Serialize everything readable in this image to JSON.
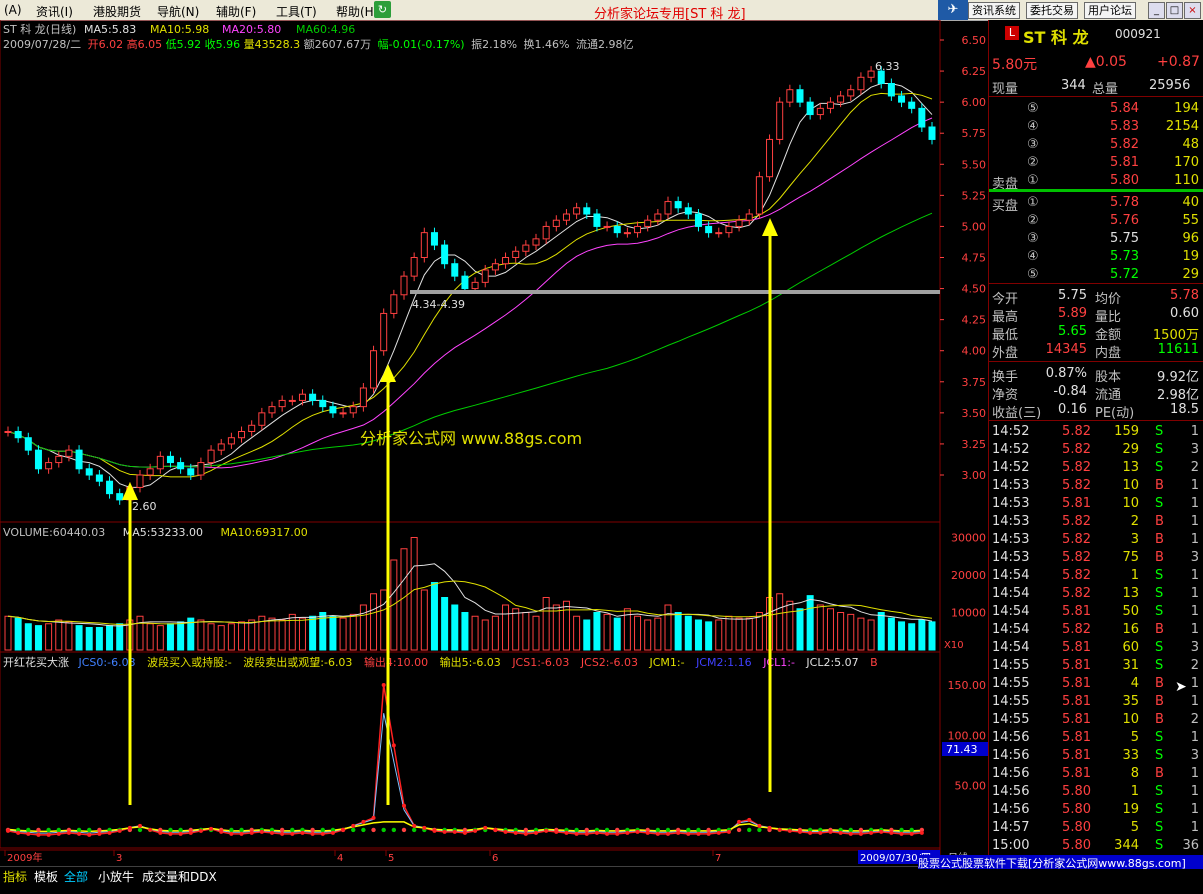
{
  "menu": {
    "items": [
      "(A)",
      "资讯(I)",
      "港股期货",
      "导航(N)",
      "辅助(F)",
      "工具(T)",
      "帮助(H)"
    ],
    "title": "分析家论坛专用[ST 科 龙]",
    "buttons": [
      "资讯系统",
      "委托交易",
      "用户论坛"
    ],
    "window_controls": [
      "_",
      "□",
      "×"
    ]
  },
  "chart": {
    "header1": {
      "name": "ST 科 龙(日线)",
      "ma5": "MA5:5.83",
      "ma10": "MA10:5.98",
      "ma20": "MA20:5.80",
      "ma60": "MA60:4.96"
    },
    "header2": {
      "date": "2009/07/28/二",
      "open": "开6.02",
      "high": "高6.05",
      "low": "低5.92",
      "close": "收5.96",
      "vol": "量43528.3",
      "amt": "额2607.67万",
      "chg": "幅-0.01(-0.17%)",
      "amp": "振2.18%",
      "turn": "换1.46%",
      "float": "流通2.98亿"
    },
    "price_axis": [
      "6.50",
      "6.25",
      "6.00",
      "5.75",
      "5.50",
      "5.25",
      "5.00",
      "4.75",
      "4.50",
      "4.25",
      "4.00",
      "3.75",
      "3.50",
      "3.25",
      "3.00"
    ],
    "annotations": {
      "low_label": "2.60",
      "high_label": "6.33",
      "range_label": "4.34-4.39",
      "watermark": "分析家公式网  www.88gs.com"
    },
    "volume_header": {
      "volume": "VOLUME:60440.03",
      "ma5": "MA5:53233.00",
      "ma10": "MA10:69317.00"
    },
    "volume_axis": [
      "30000",
      "20000",
      "10000"
    ],
    "volume_unit": "X10",
    "indicator_header": {
      "name": "开红花买大涨",
      "jcs0": "JCS0:-6.03",
      "buy": "波段买入或持股:-",
      "sell": "波段卖出或观望:-6.03",
      "out1": "输出4:10.00",
      "out5": "输出5:-6.03",
      "jcs1": "JCS1:-6.03",
      "jcs2": "JCS2:-6.03",
      "jcm1": "JCM1:-",
      "jcm2": "JCM2:1.16",
      "jcl1": "JCL1:-",
      "jcl2": "JCL2:5.07",
      "b": "B"
    },
    "indicator_axis": [
      "150.00",
      "100.00",
      "50.00"
    ],
    "indicator_current": "71.43",
    "date_axis": [
      "2009年",
      "3",
      "4",
      "5",
      "6",
      "7"
    ],
    "date_end": "2009/07/30/四",
    "period": "日线"
  },
  "side": {
    "badge": "L",
    "stock_name": "ST 科 龙",
    "code": "000921",
    "price": "5.80元",
    "change": "▲0.05",
    "change2": "+0.87",
    "now_vol_label": "现量",
    "now_vol": "344",
    "total_vol_label": "总量",
    "total_vol": "25956",
    "sell_label": "卖盘",
    "buy_label": "买盘",
    "sells": [
      {
        "lvl": "⑤",
        "price": "5.84",
        "vol": "194"
      },
      {
        "lvl": "④",
        "price": "5.83",
        "vol": "2154"
      },
      {
        "lvl": "③",
        "price": "5.82",
        "vol": "48"
      },
      {
        "lvl": "②",
        "price": "5.81",
        "vol": "170"
      },
      {
        "lvl": "①",
        "price": "5.80",
        "vol": "110"
      }
    ],
    "buys": [
      {
        "lvl": "①",
        "price": "5.78",
        "vol": "40"
      },
      {
        "lvl": "②",
        "price": "5.76",
        "vol": "55"
      },
      {
        "lvl": "③",
        "price": "5.75",
        "vol": "96"
      },
      {
        "lvl": "④",
        "price": "5.73",
        "vol": "19"
      },
      {
        "lvl": "⑤",
        "price": "5.72",
        "vol": "29"
      }
    ],
    "stats1": [
      {
        "l1": "今开",
        "v1": "5.75",
        "l2": "均价",
        "v2": "5.78"
      },
      {
        "l1": "最高",
        "v1": "5.89",
        "l2": "量比",
        "v2": "0.60"
      },
      {
        "l1": "最低",
        "v1": "5.65",
        "l2": "金额",
        "v2": "1500万"
      },
      {
        "l1": "外盘",
        "v1": "14345",
        "l2": "内盘",
        "v2": "11611"
      }
    ],
    "stats2": [
      {
        "l1": "换手",
        "v1": "0.87%",
        "l2": "股本",
        "v2": "9.92亿"
      },
      {
        "l1": "净资",
        "v1": "-0.84",
        "l2": "流通",
        "v2": "2.98亿"
      },
      {
        "l1": "收益(三)",
        "v1": "0.16",
        "l2": "PE(动)",
        "v2": "18.5"
      }
    ],
    "ticks": [
      {
        "t": "14:52",
        "p": "5.82",
        "v": "159",
        "d": "S",
        "n": "1"
      },
      {
        "t": "14:52",
        "p": "5.82",
        "v": "29",
        "d": "S",
        "n": "3"
      },
      {
        "t": "14:52",
        "p": "5.82",
        "v": "13",
        "d": "S",
        "n": "2"
      },
      {
        "t": "14:53",
        "p": "5.82",
        "v": "10",
        "d": "B",
        "n": "1"
      },
      {
        "t": "14:53",
        "p": "5.81",
        "v": "10",
        "d": "S",
        "n": "1"
      },
      {
        "t": "14:53",
        "p": "5.82",
        "v": "2",
        "d": "B",
        "n": "1"
      },
      {
        "t": "14:53",
        "p": "5.82",
        "v": "3",
        "d": "B",
        "n": "1"
      },
      {
        "t": "14:53",
        "p": "5.82",
        "v": "75",
        "d": "B",
        "n": "3"
      },
      {
        "t": "14:54",
        "p": "5.82",
        "v": "1",
        "d": "S",
        "n": "1"
      },
      {
        "t": "14:54",
        "p": "5.82",
        "v": "13",
        "d": "S",
        "n": "1"
      },
      {
        "t": "14:54",
        "p": "5.81",
        "v": "50",
        "d": "S",
        "n": "1"
      },
      {
        "t": "14:54",
        "p": "5.82",
        "v": "16",
        "d": "B",
        "n": "1"
      },
      {
        "t": "14:54",
        "p": "5.81",
        "v": "60",
        "d": "S",
        "n": "3"
      },
      {
        "t": "14:55",
        "p": "5.81",
        "v": "31",
        "d": "S",
        "n": "2"
      },
      {
        "t": "14:55",
        "p": "5.81",
        "v": "4",
        "d": "B",
        "n": "1"
      },
      {
        "t": "14:55",
        "p": "5.81",
        "v": "35",
        "d": "B",
        "n": "1"
      },
      {
        "t": "14:55",
        "p": "5.81",
        "v": "10",
        "d": "B",
        "n": "2"
      },
      {
        "t": "14:56",
        "p": "5.81",
        "v": "5",
        "d": "S",
        "n": "1"
      },
      {
        "t": "14:56",
        "p": "5.81",
        "v": "33",
        "d": "S",
        "n": "3"
      },
      {
        "t": "14:56",
        "p": "5.81",
        "v": "8",
        "d": "B",
        "n": "1"
      },
      {
        "t": "14:56",
        "p": "5.80",
        "v": "1",
        "d": "S",
        "n": "1"
      },
      {
        "t": "14:56",
        "p": "5.80",
        "v": "19",
        "d": "S",
        "n": "1"
      },
      {
        "t": "14:57",
        "p": "5.80",
        "v": "5",
        "d": "S",
        "n": "1"
      },
      {
        "t": "15:00",
        "p": "5.80",
        "v": "344",
        "d": "S",
        "n": "36"
      }
    ]
  },
  "bottom": {
    "tabs": [
      "指标",
      "模板",
      "全部",
      "小放牛",
      "成交量和DDX"
    ],
    "ad": "股票公式股票软件下载[分析家公式网www.88gs.com]"
  },
  "chart_data": {
    "type": "candlestick",
    "ylim": [
      2.6,
      6.5
    ],
    "closes": [
      3.35,
      3.3,
      3.2,
      3.05,
      3.1,
      3.15,
      3.2,
      3.05,
      3.0,
      2.95,
      2.85,
      2.8,
      2.9,
      3.0,
      3.05,
      3.15,
      3.1,
      3.05,
      3.0,
      3.1,
      3.2,
      3.25,
      3.3,
      3.35,
      3.4,
      3.5,
      3.55,
      3.6,
      3.6,
      3.65,
      3.6,
      3.55,
      3.5,
      3.5,
      3.55,
      3.7,
      4.0,
      4.3,
      4.45,
      4.6,
      4.75,
      4.95,
      4.85,
      4.7,
      4.6,
      4.5,
      4.55,
      4.65,
      4.7,
      4.75,
      4.8,
      4.85,
      4.9,
      5.0,
      5.05,
      5.1,
      5.15,
      5.1,
      5.0,
      5.0,
      4.95,
      4.95,
      5.0,
      5.05,
      5.1,
      5.2,
      5.15,
      5.1,
      5.0,
      4.95,
      4.95,
      5.0,
      5.05,
      5.1,
      5.4,
      5.7,
      6.0,
      6.1,
      6.0,
      5.9,
      5.95,
      6.0,
      6.05,
      6.1,
      6.2,
      6.25,
      6.15,
      6.05,
      6.0,
      5.95,
      5.8,
      5.7
    ],
    "volume_ylim": [
      0,
      32000
    ],
    "volumes": [
      9000,
      8500,
      7000,
      6500,
      7000,
      8000,
      7500,
      6500,
      6000,
      6000,
      6500,
      7000,
      8000,
      9000,
      7000,
      6500,
      7000,
      7500,
      8500,
      8000,
      7000,
      6500,
      7000,
      7500,
      8000,
      9000,
      8500,
      8000,
      9500,
      8500,
      9000,
      10000,
      9000,
      8500,
      9500,
      12000,
      15000,
      16000,
      24000,
      27000,
      30000,
      16000,
      18000,
      14000,
      12000,
      10000,
      9000,
      8000,
      9000,
      12000,
      11000,
      10000,
      9000,
      14000,
      12000,
      13000,
      9000,
      8000,
      10000,
      9500,
      8500,
      11000,
      9000,
      8000,
      8500,
      12000,
      10000,
      9000,
      8000,
      7500,
      8000,
      9000,
      8500,
      8500,
      10000,
      14000,
      15000,
      13000,
      11000,
      14500,
      12000,
      11000,
      10000,
      9500,
      8500,
      8000,
      10000,
      8500,
      7500,
      7000,
      8000,
      7500
    ],
    "indicator_ylim": [
      -10,
      160
    ],
    "indicator": [
      5,
      3,
      2,
      1,
      1,
      2,
      3,
      2,
      1,
      2,
      3,
      5,
      8,
      10,
      6,
      3,
      2,
      2,
      3,
      5,
      7,
      4,
      2,
      2,
      3,
      4,
      3,
      2,
      2,
      3,
      2,
      2,
      3,
      6,
      10,
      14,
      18,
      150,
      90,
      30,
      10,
      8,
      5,
      4,
      4,
      3,
      5,
      8,
      6,
      4,
      3,
      2,
      3,
      5,
      4,
      3,
      2,
      2,
      3,
      2,
      2,
      3,
      4,
      3,
      2,
      2,
      3,
      2,
      2,
      2,
      3,
      4,
      14,
      16,
      10,
      8,
      6,
      5,
      4,
      3,
      3,
      4,
      3,
      2,
      2,
      3,
      4,
      3,
      2,
      2,
      3
    ]
  }
}
